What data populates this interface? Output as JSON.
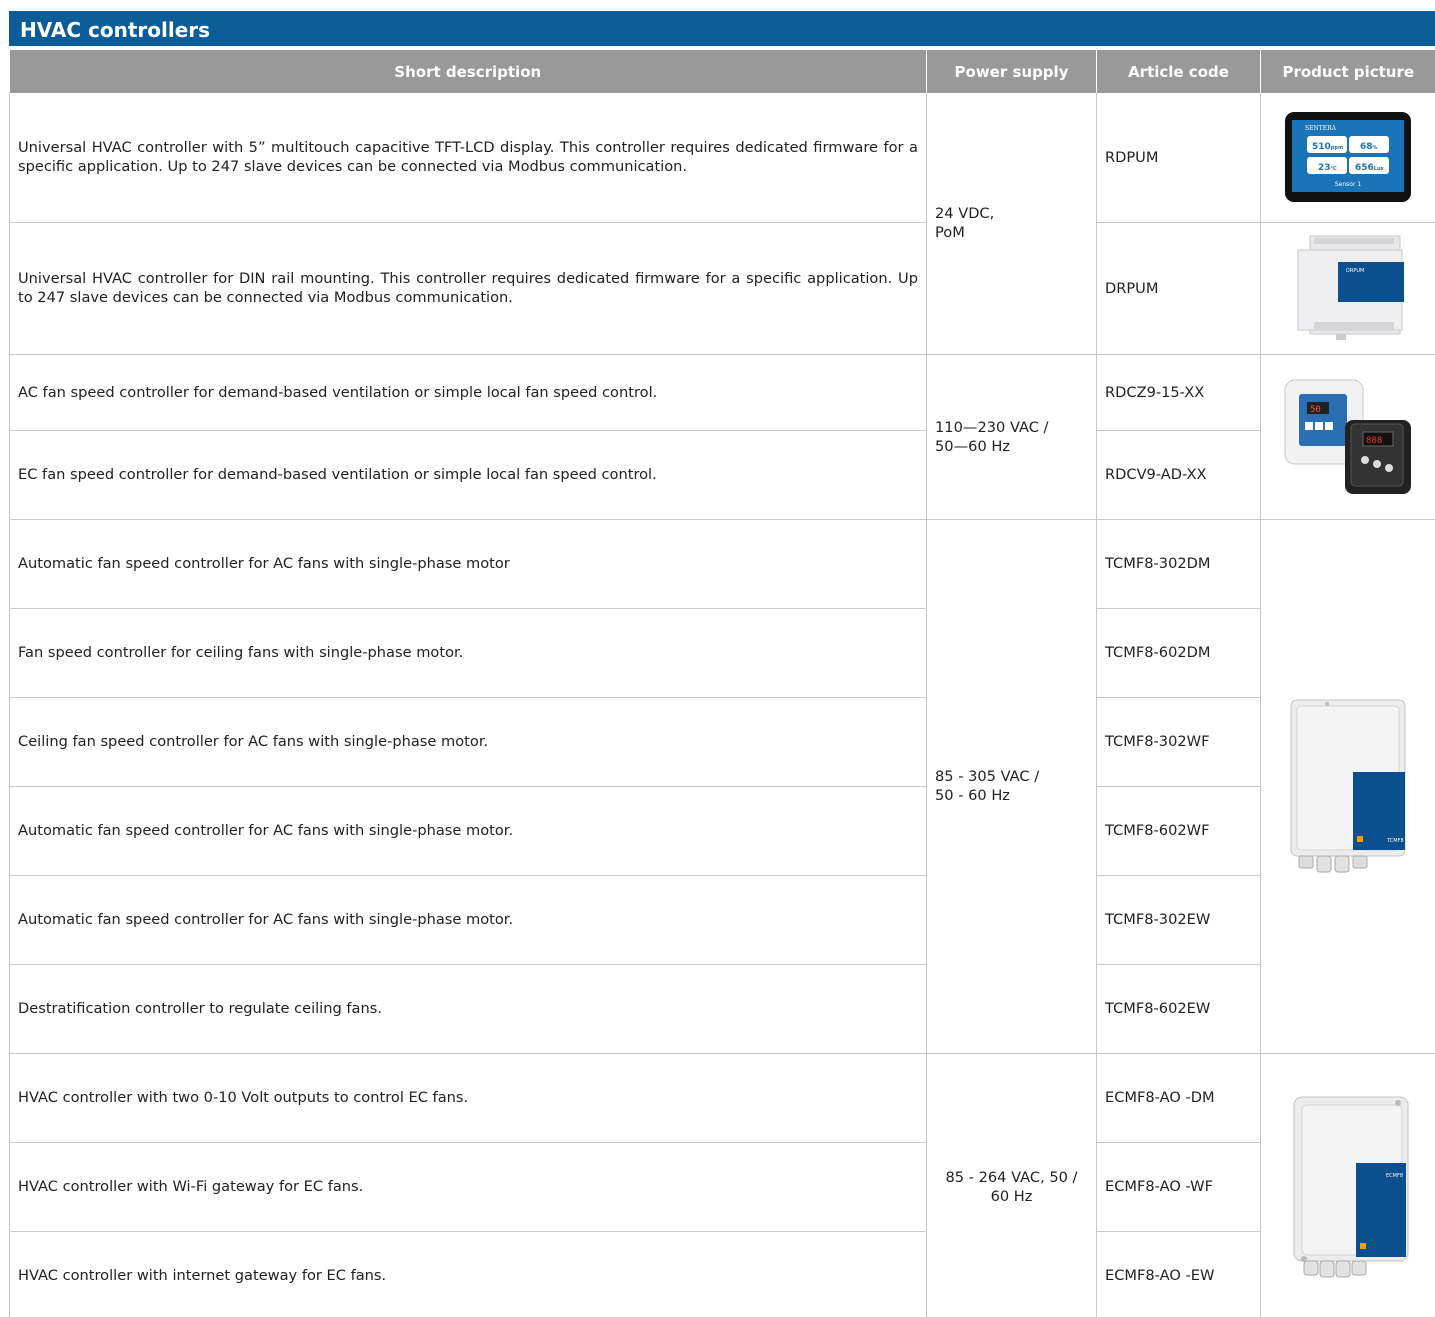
{
  "title": "HVAC controllers",
  "headers": {
    "description": "Short description",
    "supply": "Power supply",
    "code": "Article code",
    "picture": "Product picture"
  },
  "groups": [
    {
      "supply": "24 VDC,\nPoM",
      "picture_icon": "touch-display-controller-image",
      "rows": [
        {
          "description": "Universal HVAC controller with 5” multitouch capacitive TFT-LCD display. This controller requires dedicated firmware for a specific application. Up to 247 slave devices can be connected via Modbus communication.",
          "code": "RDPUM"
        },
        {
          "description": "Universal HVAC controller for DIN rail mounting. This controller requires dedicated firmware for a specific application. Up to 247 slave devices can be connected via Modbus communication.",
          "code": "DRPUM"
        }
      ]
    },
    {
      "supply": "110—230 VAC /\n50—60 Hz",
      "picture_icon": "fan-speed-controllers-image",
      "rows": [
        {
          "description": "AC fan speed controller for demand-based ventilation or simple local fan speed control.",
          "code": "RDCZ9-15-XX"
        },
        {
          "description": "EC fan speed controller for demand-based ventilation or simple local fan speed control.",
          "code": "RDCV9-AD-XX"
        }
      ]
    },
    {
      "supply": "85 - 305 VAC /\n50 - 60 Hz",
      "picture_icon": "tcmf8-enclosure-image",
      "rows": [
        {
          "description": "Automatic fan speed controller for AC fans with single-phase motor",
          "code": "TCMF8-302DM"
        },
        {
          "description": "Fan speed controller for ceiling fans with single-phase motor.",
          "code": "TCMF8-602DM"
        },
        {
          "description": "Ceiling fan speed controller for AC fans with single-phase motor.",
          "code": "TCMF8-302WF"
        },
        {
          "description": "Automatic fan speed controller for AC fans with single-phase motor.",
          "code": "TCMF8-602WF"
        },
        {
          "description": "Automatic fan speed controller for AC fans with single-phase motor.",
          "code": "TCMF8-302EW"
        },
        {
          "description": "Destratification controller to regulate ceiling fans.",
          "code": "TCMF8-602EW"
        }
      ]
    },
    {
      "supply": "85 - 264 VAC, 50 /\n60 Hz",
      "picture_icon": "ecmf8-enclosure-image",
      "rows": [
        {
          "description": "HVAC controller with two 0-10 Volt outputs to control EC fans.",
          "code": "ECMF8-AO -DM"
        },
        {
          "description": "HVAC controller with Wi-Fi gateway for EC fans.",
          "code": "ECMF8-AO -WF"
        },
        {
          "description": "HVAC controller with internet gateway for EC fans.",
          "code": "ECMF8-AO -EW"
        }
      ]
    }
  ],
  "pictures": {
    "rdpum": {
      "brand": "SENTERA",
      "v1": "510",
      "u1": "ppm",
      "v2": "68",
      "u2": "%",
      "v3": "23",
      "u3": "°C",
      "v4": "656",
      "u4": "Lux",
      "caption": "Sensor 1"
    },
    "drpum": {
      "label": "DRPUM"
    },
    "rdc": {
      "display": "50"
    },
    "tcmf8": {
      "label": "TCMF8"
    },
    "ecmf8": {
      "label": "ECMF8"
    }
  }
}
